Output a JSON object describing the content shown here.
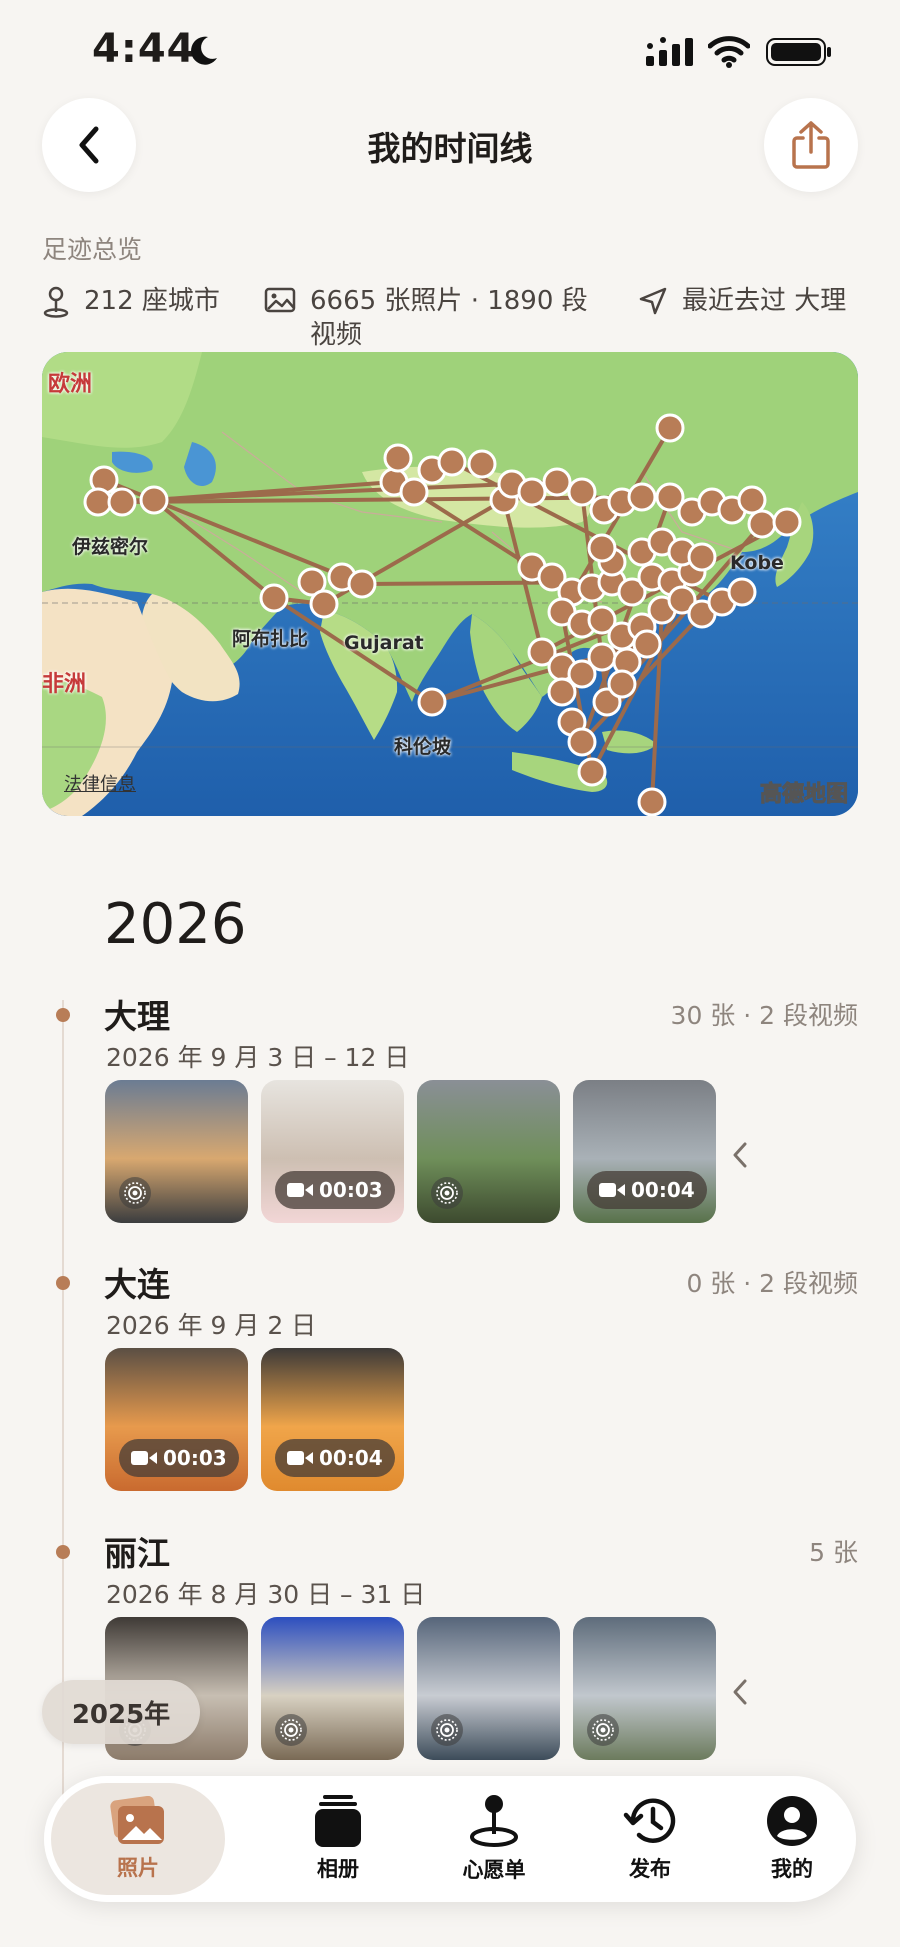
{
  "status_bar": {
    "time": "4:44"
  },
  "header": {
    "title": "我的时间线"
  },
  "summary": {
    "section_label": "足迹总览",
    "cities": "212 座城市",
    "media": "6665 张照片 · 1890 段视频",
    "recent": "最近去过 大理"
  },
  "map": {
    "labels": [
      "欧洲",
      "伊兹密尔",
      "阿布扎比",
      "Gujarat",
      "科伦坡",
      "Kobe",
      "非洲"
    ],
    "legal": "法律信息",
    "brand": "高德地图",
    "route_color": "#9c6a4b",
    "marker_color": "#b87d57"
  },
  "timeline": {
    "year": "2026",
    "entries": [
      {
        "city": "大理",
        "date": "2026 年 9 月 3 日 – 12 日",
        "count": "30 张 · 2 段视频",
        "thumbs": [
          {
            "kind": "live",
            "icon": "live-photo-icon"
          },
          {
            "kind": "video",
            "duration": "00:03"
          },
          {
            "kind": "live",
            "icon": "live-photo-icon"
          },
          {
            "kind": "video",
            "duration": "00:04"
          }
        ]
      },
      {
        "city": "大连",
        "date": "2026 年 9 月 2 日",
        "count": "0 张 · 2 段视频",
        "thumbs": [
          {
            "kind": "video",
            "duration": "00:03"
          },
          {
            "kind": "video",
            "duration": "00:04"
          }
        ]
      },
      {
        "city": "丽江",
        "date": "2026 年 8 月 30 日 – 31 日",
        "count": "5 张",
        "thumbs": [
          {
            "kind": "live",
            "icon": "live-photo-icon"
          },
          {
            "kind": "live",
            "icon": "live-photo-icon"
          },
          {
            "kind": "live",
            "icon": "live-photo-icon"
          },
          {
            "kind": "live",
            "icon": "live-photo-icon"
          }
        ]
      }
    ]
  },
  "year_chip": "2025年",
  "tabs": [
    {
      "label": "照片",
      "icon": "photos-icon",
      "active": true
    },
    {
      "label": "相册",
      "icon": "album-icon",
      "active": false
    },
    {
      "label": "心愿单",
      "icon": "pin-icon",
      "active": false
    },
    {
      "label": "发布",
      "icon": "history-icon",
      "active": false
    },
    {
      "label": "我的",
      "icon": "profile-icon",
      "active": false
    }
  ],
  "colors": {
    "accent": "#b87d57",
    "background": "#f7f5f2"
  }
}
